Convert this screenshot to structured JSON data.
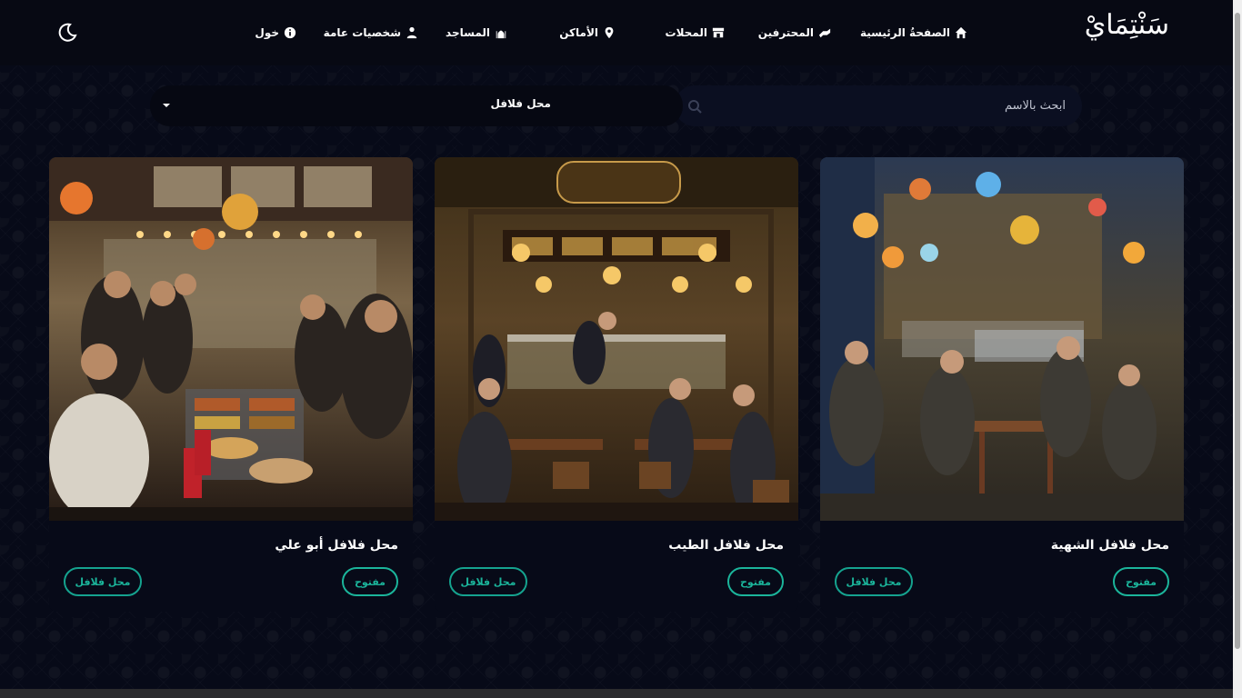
{
  "brand": {
    "logo_text": "سَنْتِمَايْ"
  },
  "nav": {
    "home": "الصفحةُ الرئيسية",
    "pros": "المحترفين",
    "shops": "المحلات",
    "places": "الأماكن",
    "mosques": "المساجد",
    "public_figures": "شخصيات عامة",
    "login": "خول"
  },
  "filters": {
    "category_selected": "محل فلافل",
    "search_placeholder": "ابحث بالاسم"
  },
  "cards": [
    {
      "title": "محل فلافل الشهية",
      "status": "مفتوح",
      "category": "محل فلافل"
    },
    {
      "title": "محل فلافل الطيب",
      "status": "مفتوح",
      "category": "محل فلافل"
    },
    {
      "title": "محل فلافل أبو علي",
      "status": "مفتوح",
      "category": "محل فلافل"
    }
  ],
  "colors": {
    "accent": "#1bb59b",
    "background": "#070a18",
    "navbar": "#070913"
  },
  "icons": {
    "home": "home-icon",
    "pros": "hand-icon",
    "shops": "store-icon",
    "places": "map-pin-icon",
    "mosques": "mosque-icon",
    "public_figures": "users-icon",
    "login": "info-icon",
    "theme": "moon-icon",
    "search": "search-icon"
  }
}
